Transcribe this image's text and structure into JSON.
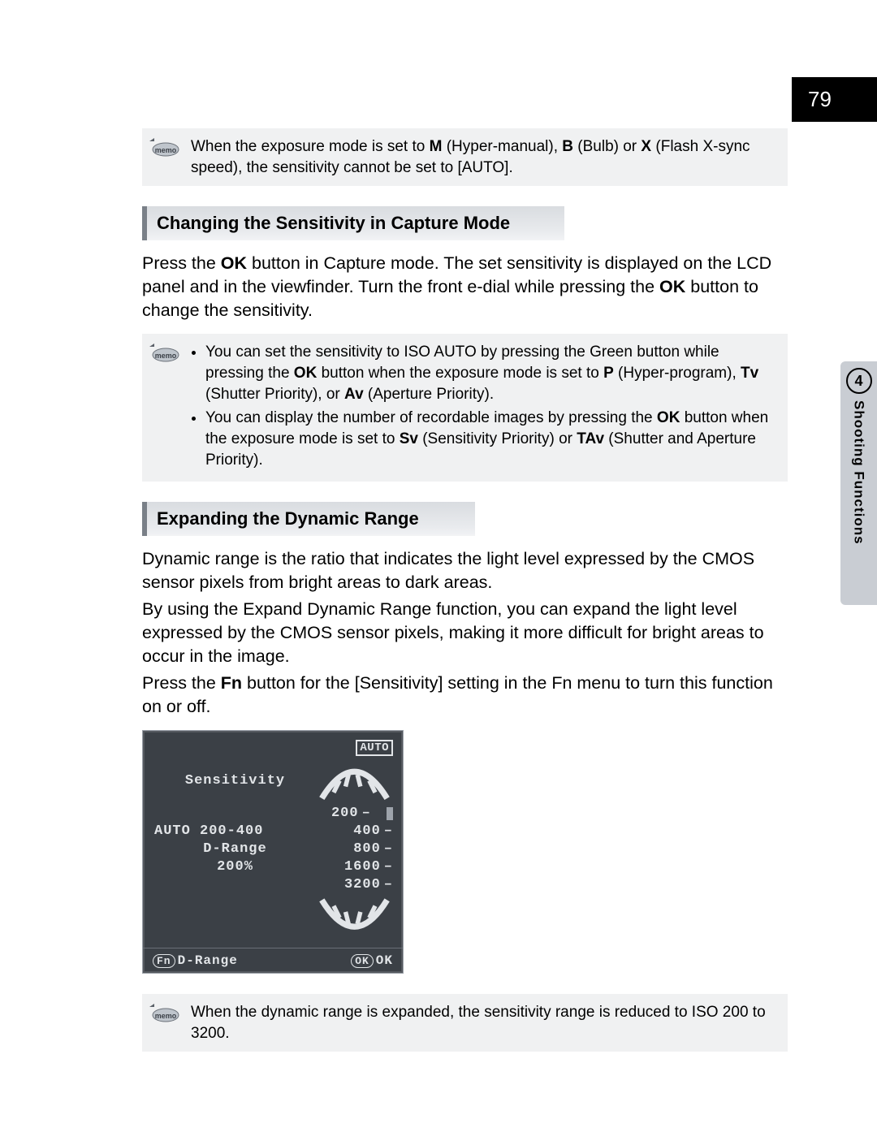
{
  "page_number": "79",
  "chapter": {
    "number": "4",
    "title": "Shooting Functions"
  },
  "memo1": {
    "text_parts": [
      "When the exposure mode is set to ",
      "M",
      " (Hyper-manual), ",
      "B",
      " (Bulb) or ",
      "X",
      " (Flash X-sync speed), the sensitivity cannot be set to [AUTO]."
    ]
  },
  "section1": {
    "heading": "Changing the Sensitivity in Capture Mode",
    "para_parts": [
      "Press the ",
      "OK",
      " button in Capture mode. The set sensitivity is displayed on the LCD panel and in the viewfinder. Turn the front e-dial while pressing the ",
      "OK",
      " button to change the sensitivity."
    ]
  },
  "memo2": {
    "bullet1_parts": [
      "You can set the sensitivity to ISO AUTO by pressing the Green button while pressing the ",
      "OK",
      " button when the exposure mode is set to ",
      "P",
      " (Hyper-program), ",
      "Tv",
      " (Shutter Priority), or ",
      "Av",
      " (Aperture Priority)."
    ],
    "bullet2_parts": [
      "You can display the number of recordable images by pressing the ",
      "OK",
      " button when the exposure mode is set to ",
      "Sv",
      " (Sensitivity Priority) or ",
      "TAv",
      " (Shutter and Aperture Priority)."
    ]
  },
  "section2": {
    "heading": "Expanding the Dynamic Range",
    "para1": "Dynamic range is the ratio that indicates the light level expressed by the CMOS sensor pixels from bright areas to dark areas.",
    "para2": "By using the Expand Dynamic Range function, you can expand the light level expressed by the CMOS sensor pixels, making it more difficult for bright areas to occur in the image.",
    "para3_parts": [
      "Press the ",
      "Fn",
      " button for the [Sensitivity] setting in the Fn menu to turn this function on or off."
    ]
  },
  "lcd": {
    "auto_badge": "AUTO",
    "label_sensitivity": "Sensitivity",
    "auto_range": "AUTO 200-400",
    "drange_label": "D-Range",
    "drange_value": "200%",
    "iso_values": [
      "200",
      "400",
      "800",
      "1600",
      "3200"
    ],
    "fn_label": "Fn",
    "fn_text": "D-Range",
    "ok_label": "OK",
    "ok_text": "OK"
  },
  "memo3": {
    "text": "When the dynamic range is expanded, the sensitivity range is reduced to ISO 200 to 3200."
  }
}
